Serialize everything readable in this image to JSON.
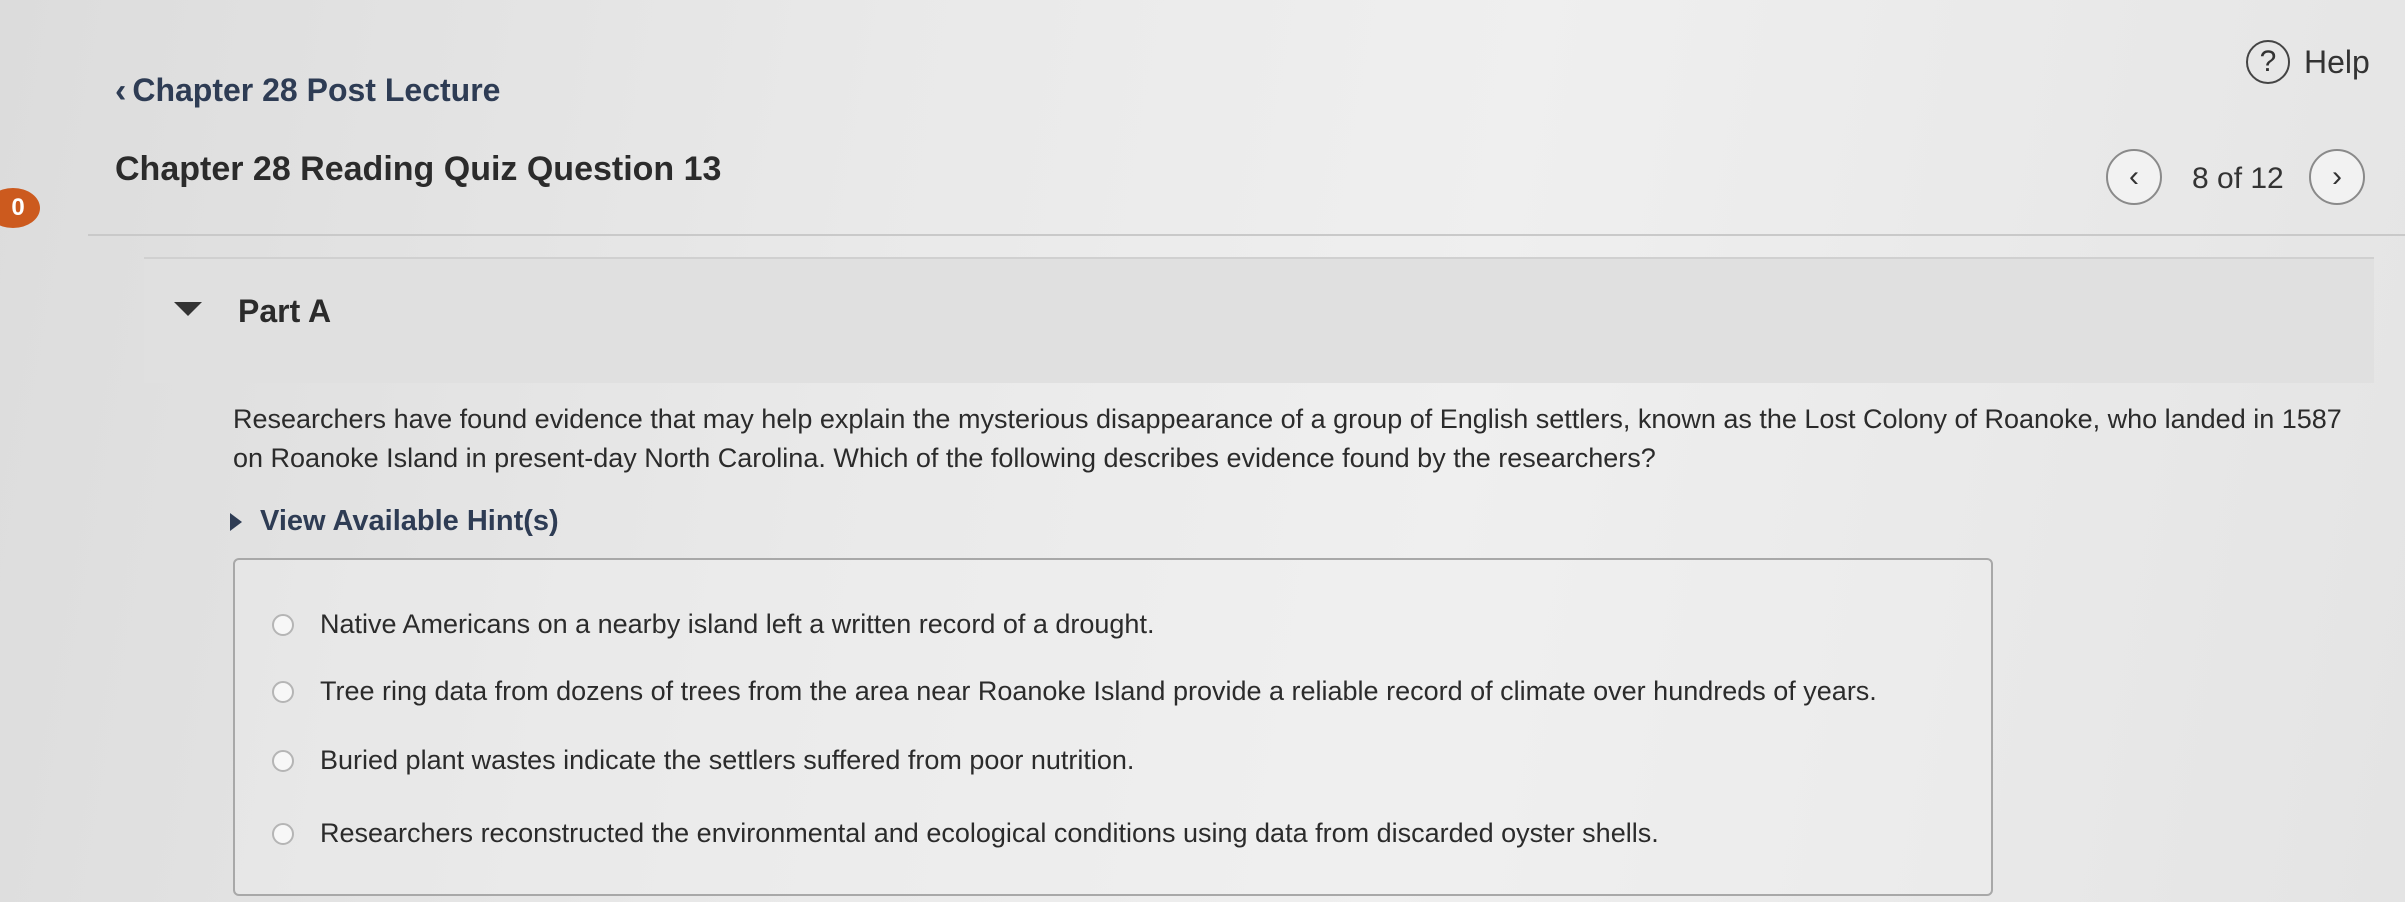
{
  "header": {
    "back_link": "Chapter 28 Post Lecture",
    "help_label": "Help",
    "question_title": "Chapter 28 Reading Quiz Question 13",
    "pager": "8 of 12",
    "badge": "0"
  },
  "part": {
    "title": "Part A"
  },
  "question": {
    "text": "Researchers have found evidence that may help explain the mysterious disappearance of a group of English settlers, known as the Lost Colony of Roanoke, who landed in 1587 on Roanoke Island in present-day North Carolina. Which of the following describes evidence found by the researchers?",
    "hint_label": "View Available Hint(s)",
    "options": [
      "Native Americans on a nearby island left a written record of a drought.",
      "Tree ring data from dozens of trees from the area near Roanoke Island provide a reliable record of climate over hundreds of years.",
      "Buried plant wastes indicate the settlers suffered from poor nutrition.",
      "Researchers reconstructed the environmental and ecological conditions using data from discarded oyster shells."
    ]
  },
  "icons": {
    "back": "chevron-left-icon",
    "help": "question-circle-icon",
    "prev": "chevron-left-icon",
    "next": "chevron-right-icon",
    "part_toggle": "caret-down-icon",
    "hint_toggle": "caret-right-icon"
  },
  "colors": {
    "link": "#2e3c54",
    "badge": "#cc5a1e"
  }
}
